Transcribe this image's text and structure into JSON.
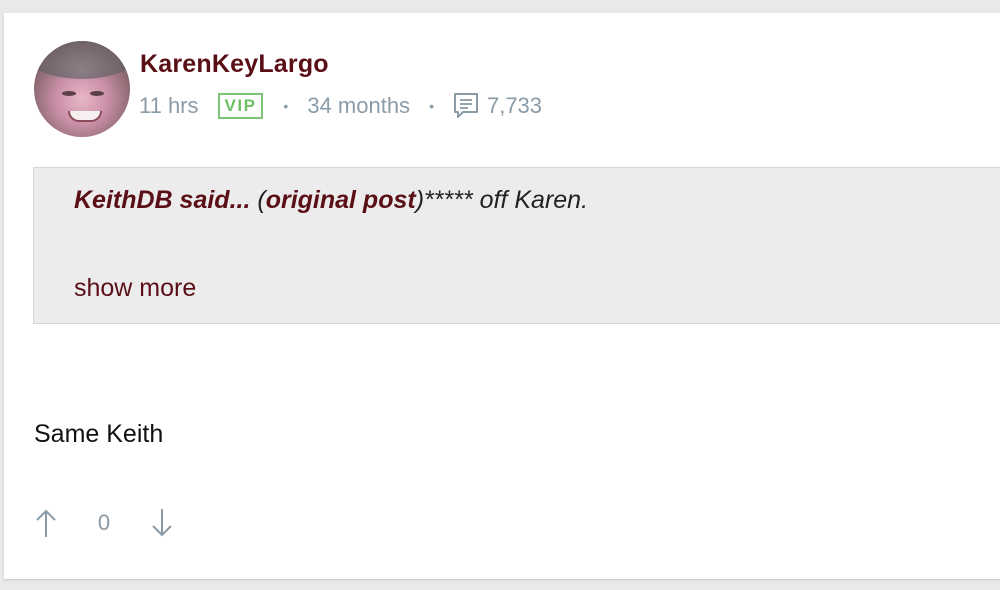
{
  "post": {
    "author": "KarenKeyLargo",
    "time_ago": "11 hrs",
    "badge": "VIP",
    "separator": "•",
    "membership": "34 months",
    "comment_count": "7,733",
    "icons": {
      "comments": "comment-bubble-icon",
      "upvote": "arrow-up-icon",
      "downvote": "arrow-down-icon"
    },
    "quote": {
      "author_label": "KeithDB said...",
      "open_paren": " (",
      "link_label": "original post",
      "close_paren": ")",
      "text": "***** off Karen.",
      "show_more": "show more"
    },
    "body": "Same Keith",
    "votes": {
      "count": "0"
    }
  },
  "colors": {
    "brand": "#5a0f17",
    "muted": "#8a9ba8",
    "vip_green": "#6cbf64",
    "quote_bg": "#ececec"
  }
}
